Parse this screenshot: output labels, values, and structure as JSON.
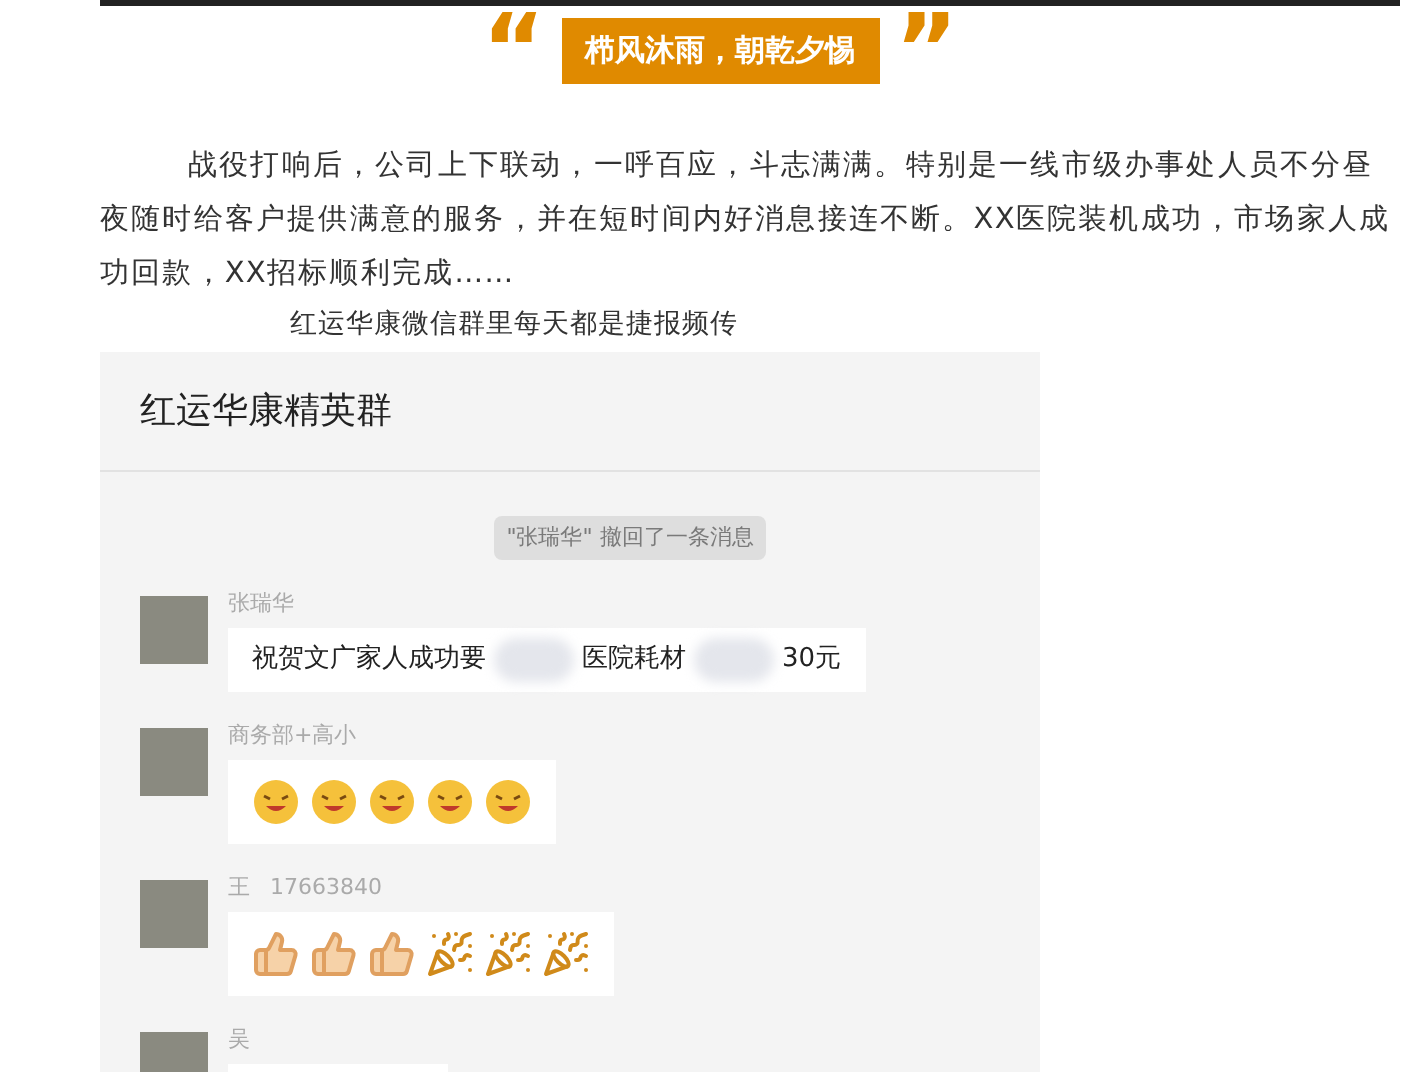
{
  "banner": {
    "open_quote": "“",
    "title": "栉风沐雨，朝乾夕惕",
    "close_quote": "”"
  },
  "paragraph": "战役打响后，公司上下联动，一呼百应，斗志满满。特别是一线市级办事处人员不分昼夜随时给客户提供满意的服务，并在短时间内好消息接连不断。XX医院装机成功，市场家人成功回款，XX招标顺利完成……",
  "caption": "红运华康微信群里每天都是捷报频传",
  "chat": {
    "title": "红运华康精英群",
    "notice": "\"张瑞华\" 撤回了一条消息",
    "messages": [
      {
        "kind": "text",
        "sender": [
          "张瑞华"
        ],
        "parts": [
          "祝贺文广家人成功要",
          "医院耗材",
          "30元"
        ]
      },
      {
        "kind": "emoji",
        "sender": [
          "商务部+高小"
        ],
        "emojis": [
          {
            "kind": "laugh"
          },
          {
            "kind": "laugh"
          },
          {
            "kind": "laugh"
          },
          {
            "kind": "laugh"
          },
          {
            "kind": "laugh"
          }
        ]
      },
      {
        "kind": "emoji",
        "sender": [
          "王",
          "17663840"
        ],
        "emojis": [
          {
            "kind": "thumbs"
          },
          {
            "kind": "thumbs"
          },
          {
            "kind": "thumbs"
          },
          {
            "kind": "party"
          },
          {
            "kind": "party"
          },
          {
            "kind": "party"
          }
        ]
      },
      {
        "kind": "cut",
        "sender": [
          "吴"
        ]
      }
    ]
  }
}
